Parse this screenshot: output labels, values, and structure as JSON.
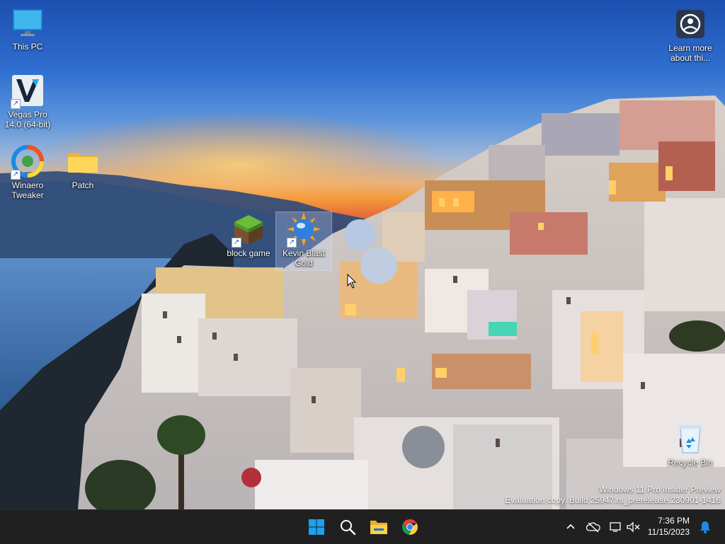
{
  "desktop": {
    "icons": {
      "this_pc": {
        "label": "This PC",
        "icon": "monitor-icon"
      },
      "vegas_pro": {
        "label": "Vegas Pro 14.0 (64-bit)",
        "icon": "vegas-pro-icon"
      },
      "winaero": {
        "label": "Winaero Tweaker",
        "icon": "winaero-tweaker-icon"
      },
      "patch": {
        "label": "Patch",
        "icon": "folder-icon"
      },
      "block_game": {
        "label": "block game",
        "icon": "grass-block-icon"
      },
      "kevin_blast": {
        "label": "Kevin Blast Gold",
        "icon": "sun-globe-icon"
      },
      "learn_more": {
        "label": "Learn more about thi...",
        "icon": "camera-lens-icon"
      },
      "recycle_bin": {
        "label": "Recycle Bin",
        "icon": "recycle-bin-icon"
      }
    },
    "watermark": {
      "line1": "Windows 11 Pro Insider Preview",
      "line2": "Evaluation copy. Build 25947.rs_prerelease.230901-1416"
    }
  },
  "taskbar": {
    "pinned": [
      {
        "name": "start",
        "icon": "windows-logo-icon"
      },
      {
        "name": "search",
        "icon": "search-icon"
      },
      {
        "name": "file-explorer",
        "icon": "folder-icon"
      },
      {
        "name": "chrome",
        "icon": "chrome-icon"
      }
    ],
    "tray": {
      "icons": [
        "chevron-up-icon",
        "onedrive-off-icon",
        "network-icon",
        "volume-muted-icon",
        "notification-bell-icon"
      ],
      "time": "7:36 PM",
      "date": "11/15/2023"
    }
  },
  "colors": {
    "taskbar_bg": "#202020",
    "accent_blue": "#0078d4"
  }
}
